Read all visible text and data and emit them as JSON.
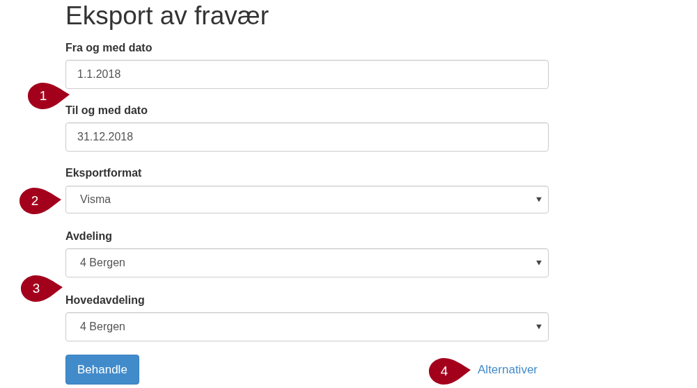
{
  "title": "Eksport av fravær",
  "fields": [
    {
      "kind": "text",
      "label": "Fra og med dato",
      "value": "1.1.2018"
    },
    {
      "kind": "text",
      "label": "Til og med dato",
      "value": "31.12.2018"
    },
    {
      "kind": "select",
      "label": "Eksportformat",
      "value": "Visma"
    },
    {
      "kind": "select",
      "label": "Avdeling",
      "value": "4 Bergen"
    },
    {
      "kind": "select",
      "label": "Hovedavdeling",
      "value": "4 Bergen"
    }
  ],
  "submit_button": "Behandle",
  "link": "Alternativer",
  "callouts": [
    {
      "number": "1"
    },
    {
      "number": "2"
    },
    {
      "number": "3"
    },
    {
      "number": "4"
    }
  ]
}
